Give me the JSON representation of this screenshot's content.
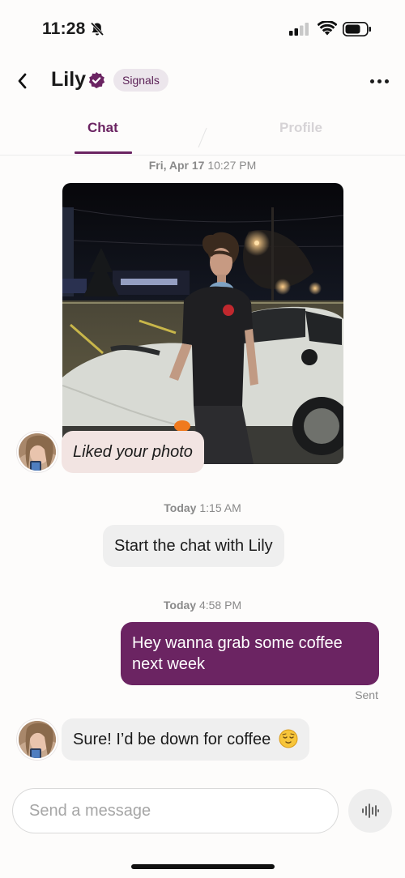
{
  "status_bar": {
    "time": "11:28",
    "icons": [
      "bell-slash-icon",
      "cellular-signal-icon",
      "wifi-icon",
      "battery-icon"
    ]
  },
  "header": {
    "contact_name": "Lily",
    "verified_icon": "verified-badge-icon",
    "chip_label": "Signals",
    "back_icon": "chevron-left-icon",
    "more_icon": "ellipsis-icon"
  },
  "tabs": [
    {
      "label": "Chat",
      "active": true
    },
    {
      "label": "Profile",
      "active": false
    }
  ],
  "messages": {
    "timestamp_1": {
      "day": "Fri, Apr 17",
      "time": "10:27 PM"
    },
    "liked_text": "Liked your photo",
    "timestamp_2": {
      "day": "Today",
      "time": "1:15 AM"
    },
    "system_text": "Start the chat with Lily",
    "timestamp_3": {
      "day": "Today",
      "time": "4:58 PM"
    },
    "sent_text": "Hey wanna grab some coffee next week",
    "sent_status": "Sent",
    "received_text": "Sure! I’d be down for coffee",
    "received_emoji": "relieved-face-emoji"
  },
  "composer": {
    "placeholder": "Send a message",
    "voice_icon": "audio-waveform-icon"
  },
  "colors": {
    "accent": "#6b2462",
    "chip_bg": "#ece6ec",
    "liked_bubble": "#f2e4e2",
    "incoming_bubble": "#efefef"
  }
}
